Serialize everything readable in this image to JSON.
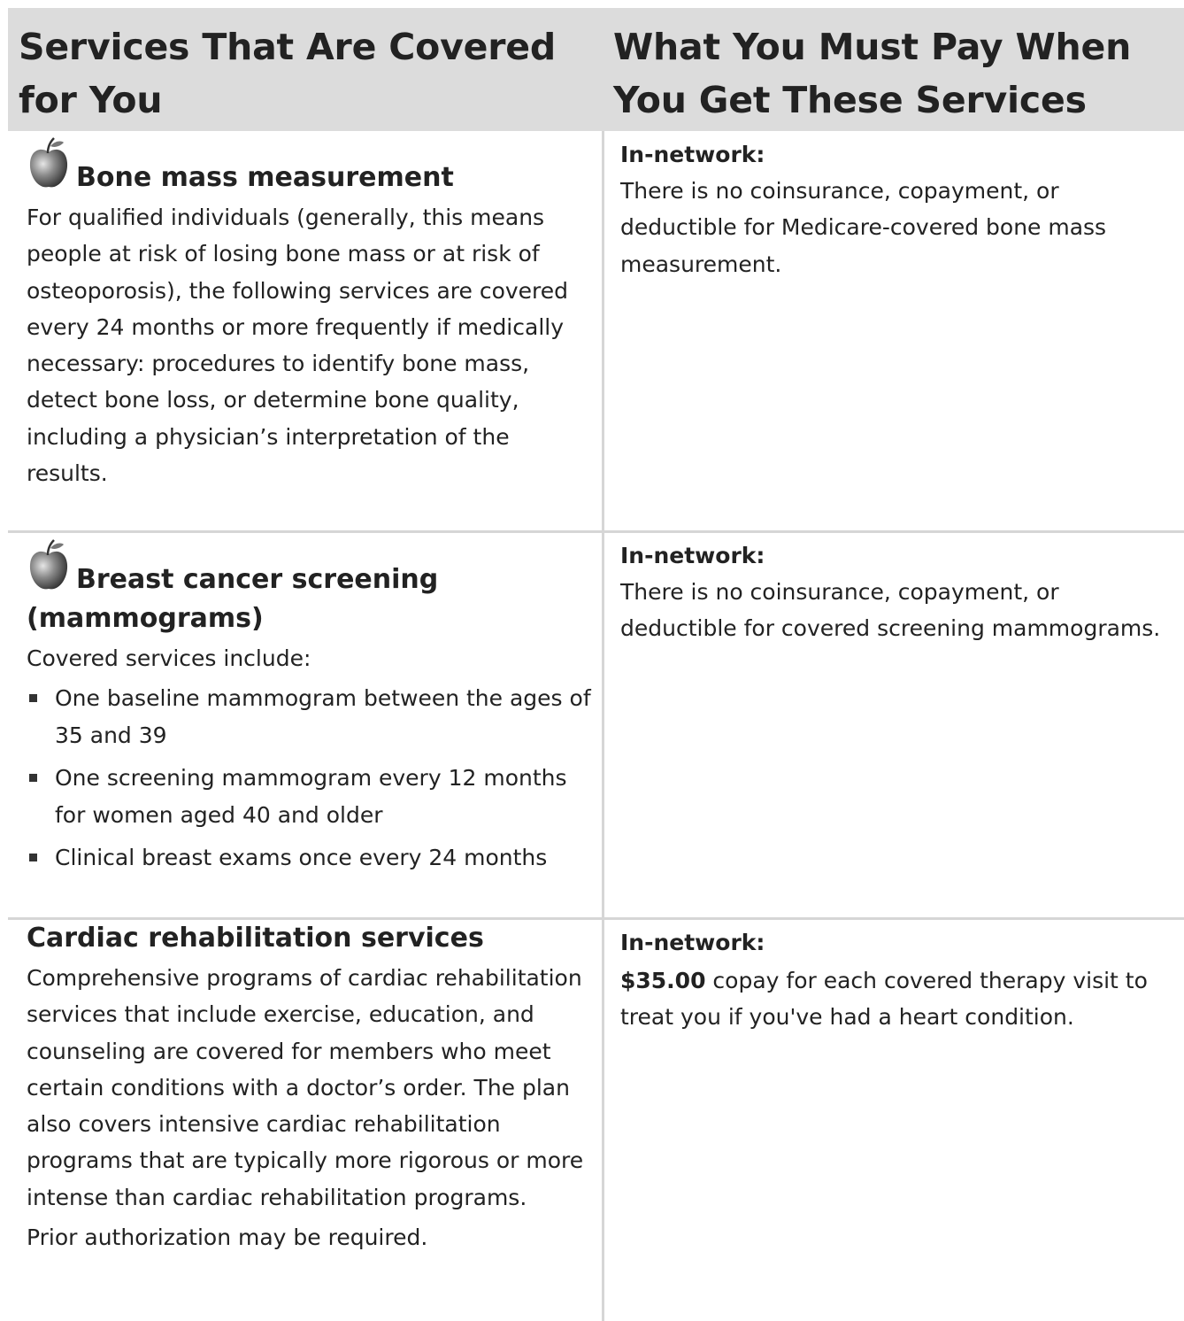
{
  "header": {
    "col1": "Services That Are Covered for You",
    "col2": "What You Must Pay When You Get These Services"
  },
  "rows": [
    {
      "icon": "apple-icon",
      "title": "Bone mass measurement",
      "description": "For qualified individuals (generally, this means people at risk of losing bone mass or at risk of osteoporosis), the following services are covered every 24 months or more frequently if medically necessary:  procedures to identify bone mass, detect bone loss, or determine bone quality, including a physician’s interpretation of the results.",
      "network_label": "In-network:",
      "cost_text": "There is no coinsurance, copayment, or deductible for Medicare-covered bone mass measurement."
    },
    {
      "icon": "apple-icon",
      "title": "Breast cancer screening (mammograms)",
      "intro": "Covered services include:",
      "bullets": [
        "One baseline mammogram between the ages of 35 and 39",
        "One screening mammogram every 12 months for women aged 40 and older",
        "Clinical breast exams once every 24 months"
      ],
      "network_label": "In-network:",
      "cost_text": "There is no coinsurance, copayment, or deductible for covered screening mammograms."
    },
    {
      "title": "Cardiac rehabilitation services",
      "description": "Comprehensive programs of cardiac rehabilitation services that include exercise, education, and counseling are covered for members who meet certain conditions with a doctor’s order. The plan also covers intensive cardiac rehabilitation programs that are typically more rigorous or more intense than cardiac rehabilitation programs.",
      "note": "Prior authorization may be required.",
      "network_label": "In-network:",
      "cost_amount": "$35.00",
      "cost_text": " copay for each covered therapy visit to treat you if you've had a heart condition."
    }
  ]
}
